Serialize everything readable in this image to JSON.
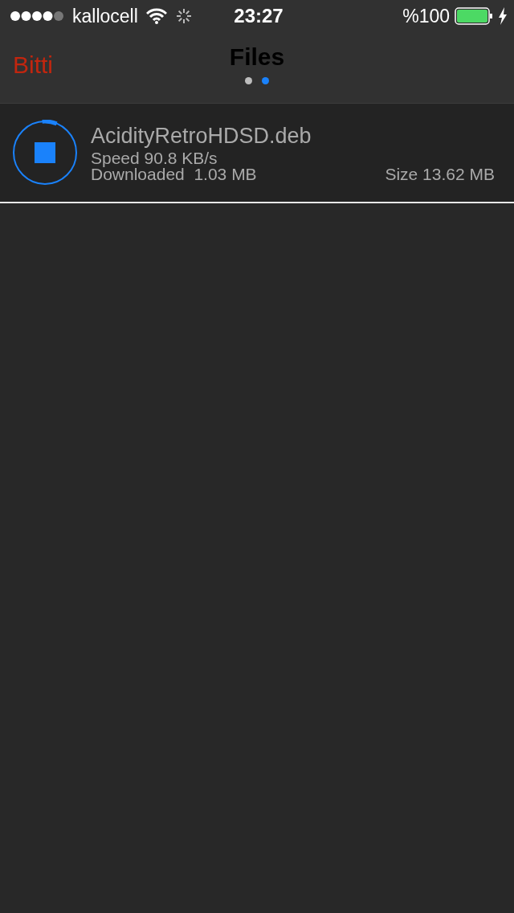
{
  "status_bar": {
    "carrier": "kallocell",
    "time": "23:27",
    "battery": "%100"
  },
  "nav": {
    "back": "Bitti",
    "title": "Files",
    "pages": [
      {
        "selected": false
      },
      {
        "selected": true
      }
    ]
  },
  "downloads": [
    {
      "name": "AcidityRetroHDSD.deb",
      "speed": "Speed 90.8 KB/s",
      "downloaded": "Downloaded  1.03 MB",
      "size": "Size 13.62 MB",
      "level": 0.075
    }
  ]
}
